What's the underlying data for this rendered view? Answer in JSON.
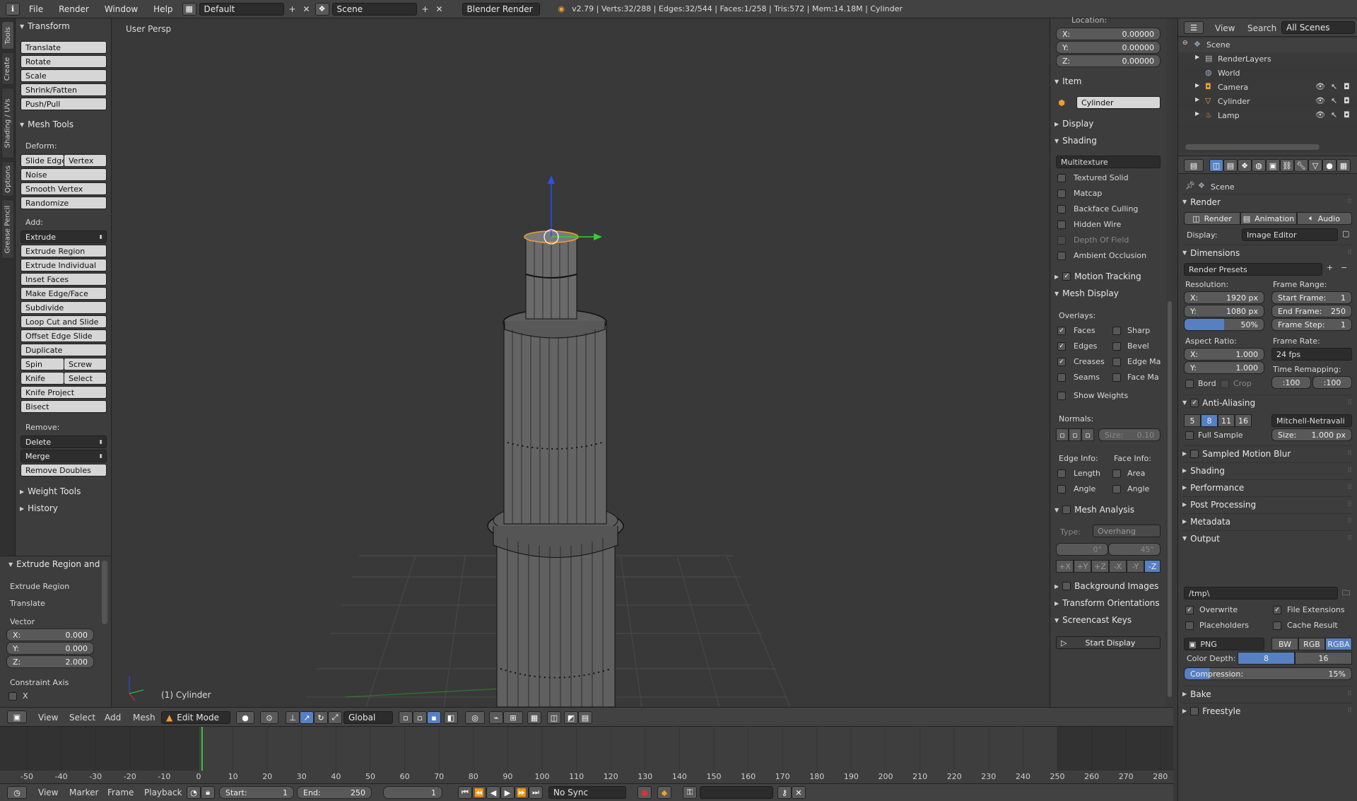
{
  "header": {
    "menus": [
      "File",
      "Render",
      "Window",
      "Help"
    ],
    "layout": "Default",
    "scene": "Scene",
    "engine": "Blender Render",
    "stats": "v2.79 | Verts:32/288 | Edges:32/544 | Faces:1/258 | Tris:572 | Mem:14.18M | Cylinder"
  },
  "vtabs": [
    "Tools",
    "Create",
    "Shading / UVs",
    "Options",
    "Grease Pencil"
  ],
  "toolshelf": {
    "transform": {
      "title": "Transform",
      "items": [
        "Translate",
        "Rotate",
        "Scale",
        "Shrink/Fatten",
        "Push/Pull"
      ]
    },
    "meshtools": {
      "title": "Mesh Tools",
      "deform_label": "Deform:",
      "slide_edge": "Slide Edge",
      "vertex": "Vertex",
      "deform": [
        "Noise",
        "Smooth Vertex",
        "Randomize"
      ],
      "add_label": "Add:",
      "extrude": "Extrude",
      "add": [
        "Extrude Region",
        "Extrude Individual",
        "Inset Faces",
        "Make Edge/Face",
        "Subdivide",
        "Loop Cut and Slide",
        "Offset Edge Slide",
        "Duplicate"
      ],
      "spin": "Spin",
      "screw": "Screw",
      "knife": "Knife",
      "select": "Select",
      "knife_project": "Knife Project",
      "bisect": "Bisect",
      "remove_label": "Remove:",
      "delete": "Delete",
      "merge": "Merge",
      "remove_doubles": "Remove Doubles"
    },
    "weight_tools": "Weight Tools",
    "history": "History"
  },
  "operator": {
    "title": "Extrude Region and",
    "extrude_region": "Extrude Region",
    "translate": "Translate",
    "vector_label": "Vector",
    "x_label": "X:",
    "x": "0.000",
    "y_label": "Y:",
    "y": "0.000",
    "z_label": "Z:",
    "z": "2.000",
    "constraint": "Constraint Axis",
    "cx": "X"
  },
  "viewport": {
    "label": "User Persp",
    "object": "(1) Cylinder"
  },
  "npanel": {
    "location": "Location:",
    "lx": "X:",
    "lxv": "0.00000",
    "ly": "Y:",
    "lyv": "0.00000",
    "lz": "Z:",
    "lzv": "0.00000",
    "item": "Item",
    "item_name": "Cylinder",
    "display": "Display",
    "shading": "Shading",
    "shading_mode": "Multitexture",
    "shading_opts": [
      "Textured Solid",
      "Matcap",
      "Backface Culling",
      "Hidden Wire",
      "Depth Of Field",
      "Ambient Occlusion"
    ],
    "motion_tracking": "Motion Tracking",
    "mesh_display": "Mesh Display",
    "overlays": "Overlays:",
    "ov_left": [
      "Faces",
      "Edges",
      "Creases",
      "Seams"
    ],
    "ov_right": [
      "Sharp",
      "Bevel",
      "Edge Ma",
      "Face Ma"
    ],
    "show_weights": "Show Weights",
    "normals": "Normals:",
    "size": "Size:",
    "size_val": "0.10",
    "edge_info": "Edge Info:",
    "face_info": "Face Info:",
    "length": "Length",
    "area": "Area",
    "angle": "Angle",
    "mesh_analysis": "Mesh Analysis",
    "type_label": "Type:",
    "type_val": "Overhang",
    "min": "0°",
    "max": "45°",
    "axes": [
      "+X",
      "+Y",
      "+Z",
      "-X",
      "-Y",
      "-Z"
    ],
    "background_images": "Background Images",
    "transform_orientations": "Transform Orientations",
    "screencast_keys": "Screencast Keys",
    "start_display": "Start Display"
  },
  "vpheader": {
    "view": "View",
    "select": "Select",
    "add": "Add",
    "mesh": "Mesh",
    "mode": "Edit Mode",
    "orientation": "Global"
  },
  "timeline": {
    "ticks": [
      "-50",
      "-40",
      "-30",
      "-20",
      "-10",
      "0",
      "10",
      "20",
      "30",
      "40",
      "50",
      "60",
      "70",
      "80",
      "90",
      "100",
      "110",
      "120",
      "130",
      "140",
      "150",
      "160",
      "170",
      "180",
      "190",
      "200",
      "210",
      "220",
      "230",
      "240",
      "250",
      "260",
      "270",
      "280"
    ],
    "current_frame": 1
  },
  "tlheader": {
    "view": "View",
    "marker": "Marker",
    "frame": "Frame",
    "playback": "Playback",
    "start_label": "Start:",
    "start": "1",
    "end_label": "End:",
    "end": "250",
    "current": "1",
    "sync": "No Sync"
  },
  "outliner": {
    "view": "View",
    "search": "Search",
    "filter": "All Scenes",
    "items": [
      "Scene",
      "RenderLayers",
      "World",
      "Camera",
      "Cylinder",
      "Lamp"
    ]
  },
  "properties": {
    "scene": "Scene",
    "render": "Render",
    "render_btn": "Render",
    "animation_btn": "Animation",
    "audio_btn": "Audio",
    "display_label": "Display:",
    "display_val": "Image Editor",
    "dimensions": "Dimensions",
    "presets": "Render Presets",
    "resolution": "Resolution:",
    "rx": "X:",
    "rxv": "1920 px",
    "ry": "Y:",
    "ryv": "1080 px",
    "pct": "50%",
    "frame_range": "Frame Range:",
    "start_frame": "Start Frame:",
    "start_frame_v": "1",
    "end_frame": "End Frame:",
    "end_frame_v": "250",
    "frame_step": "Frame Step:",
    "frame_step_v": "1",
    "aspect": "Aspect Ratio:",
    "ax": "X:",
    "axv": "1.000",
    "ay": "Y:",
    "ayv": "1.000",
    "frame_rate": "Frame Rate:",
    "fps": "24 fps",
    "bord": "Bord",
    "crop": "Crop",
    "time_remap": "Time Remapping:",
    "tr_old": ":100",
    "tr_new": ":100",
    "anti_aliasing": "Anti-Aliasing",
    "aa_samples": [
      "5",
      "8",
      "11",
      "16"
    ],
    "filter": "Mitchell-Netravali",
    "full_sample": "Full Sample",
    "filter_size": "Size:",
    "filter_size_v": "1.000 px",
    "sampled_motion_blur": "Sampled Motion Blur",
    "shading": "Shading",
    "performance": "Performance",
    "post_processing": "Post Processing",
    "metadata": "Metadata",
    "output": "Output",
    "path": "/tmp\\",
    "overwrite": "Overwrite",
    "file_ext": "File Extensions",
    "placeholders": "Placeholders",
    "cache_result": "Cache Result",
    "format": "PNG",
    "bw": "BW",
    "rgb": "RGB",
    "rgba": "RGBA",
    "color_depth": "Color Depth:",
    "cd8": "8",
    "cd16": "16",
    "compression": "Compression:",
    "compression_v": "15%",
    "bake": "Bake",
    "freestyle": "Freestyle"
  },
  "colors": {
    "accent": "#5680c2",
    "select_orange": "#f0a030",
    "axis_z": "#2b50f0",
    "axis_y": "#30d030",
    "axis_x": "#e03030"
  }
}
